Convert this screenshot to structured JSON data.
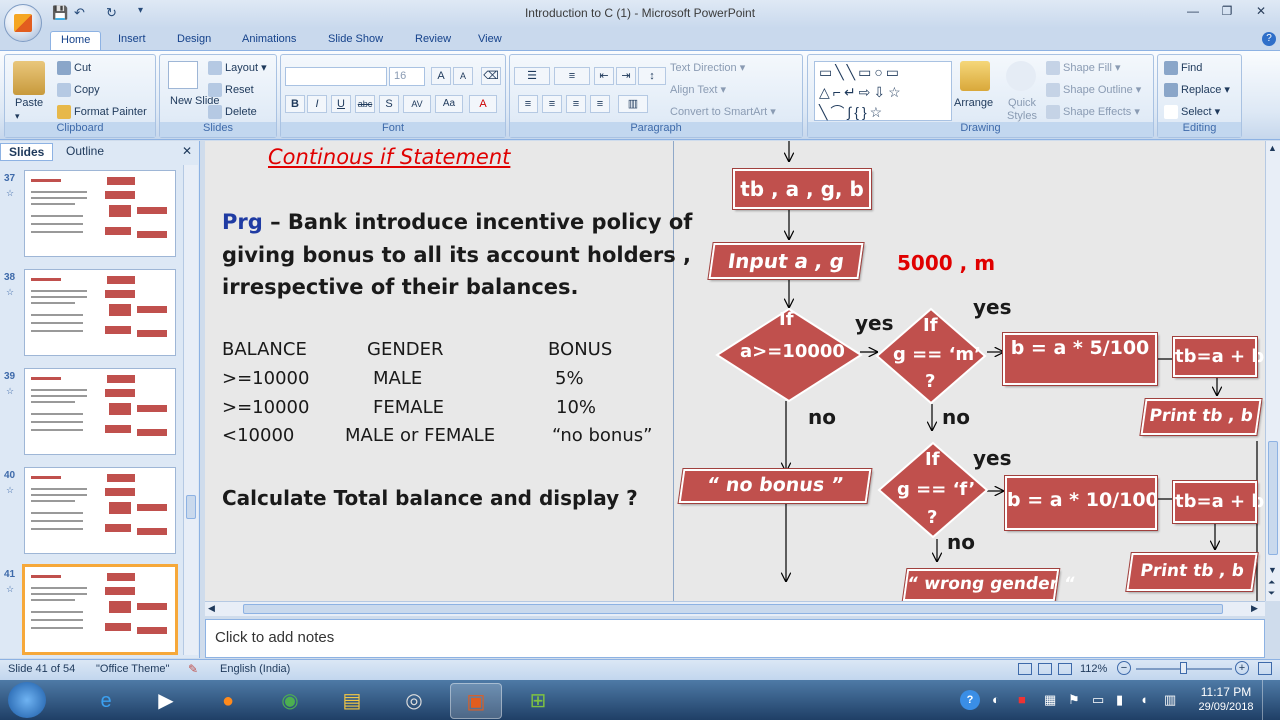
{
  "app": {
    "title": "Introduction to C (1) - Microsoft PowerPoint"
  },
  "tabs": [
    "Home",
    "Insert",
    "Design",
    "Animations",
    "Slide Show",
    "Review",
    "View"
  ],
  "ribbon": {
    "clipboard": {
      "label": "Clipboard",
      "paste": "Paste",
      "cut": "Cut",
      "copy": "Copy",
      "format_painter": "Format Painter"
    },
    "slides": {
      "label": "Slides",
      "new_slide": "New Slide",
      "layout": "Layout",
      "reset": "Reset",
      "delete": "Delete"
    },
    "font": {
      "label": "Font",
      "size": "16"
    },
    "paragraph": {
      "label": "Paragraph",
      "text_direction": "Text Direction",
      "align_text": "Align Text",
      "convert": "Convert to SmartArt"
    },
    "drawing": {
      "label": "Drawing",
      "arrange": "Arrange",
      "quick_styles": "Quick Styles",
      "shape_fill": "Shape Fill",
      "shape_outline": "Shape Outline",
      "shape_effects": "Shape Effects"
    },
    "editing": {
      "label": "Editing",
      "find": "Find",
      "replace": "Replace",
      "select": "Select"
    }
  },
  "leftpane": {
    "tab_slides": "Slides",
    "tab_outline": "Outline",
    "slide_numbers": [
      "37",
      "38",
      "39",
      "40",
      "41"
    ]
  },
  "slide": {
    "title": "Continous if Statement",
    "prg_label": "Prg",
    "prg_line1": " – Bank introduce incentive policy of",
    "prg_line2": "giving bonus  to all its account holders ,",
    "prg_line3": "irrespective of their balances.",
    "table": {
      "headers": [
        "BALANCE",
        "GENDER",
        "BONUS"
      ],
      "rows": [
        [
          ">=10000",
          "MALE",
          "5%"
        ],
        [
          ">=10000",
          "FEMALE",
          "10%"
        ],
        [
          "<10000",
          "MALE or FEMALE",
          "“no bonus”"
        ]
      ]
    },
    "question": "Calculate Total balance and display ?",
    "flow": {
      "decl": "tb , a , g, b",
      "input": "Input a , g",
      "note": "5000 , m",
      "if1_a": "If",
      "if1_b": "a>=10000",
      "if2_a": "If",
      "if2_b": "g == ‘m’",
      "if2_c": "?",
      "if3_a": "If",
      "if3_b": "g == ‘f’",
      "if3_c": "?",
      "calc_m": "b = a * 5/100",
      "calc_f": "b = a * 10/100",
      "tb1": "tb=a + b",
      "tb2": "tb=a + b",
      "print1": "Print  tb , b",
      "print2": "Print  tb , b",
      "nobonus": "“ no bonus ”",
      "wrong": "“ wrong gender “",
      "yes1": "yes",
      "yes2": "yes",
      "yes3": "yes",
      "no1": "no",
      "no2": "no",
      "no3": "no"
    }
  },
  "notes": {
    "placeholder": "Click to add notes"
  },
  "status": {
    "slide": "Slide 41 of 54",
    "theme": "\"Office Theme\"",
    "language": "English (India)",
    "zoom": "112%"
  },
  "taskbar": {
    "time": "11:17 PM",
    "date": "29/09/2018"
  }
}
